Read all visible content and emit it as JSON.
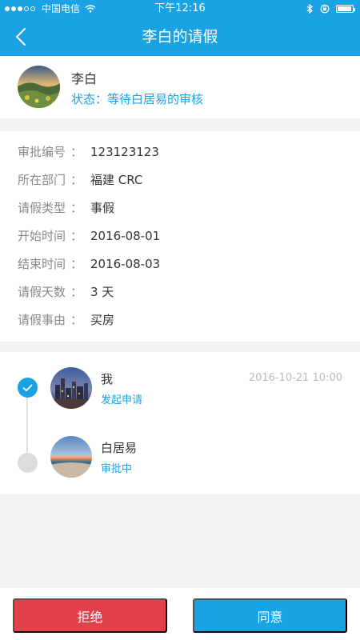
{
  "status_bar": {
    "carrier": "中国电信",
    "time": "下午12:16"
  },
  "nav": {
    "title": "李白的请假"
  },
  "profile": {
    "name": "李白",
    "status": "状态：等待白居易的审核"
  },
  "details": [
    {
      "label": "审批编号",
      "value": "123123123"
    },
    {
      "label": "所在部门",
      "value": "福建 CRC"
    },
    {
      "label": "请假类型",
      "value": "事假"
    },
    {
      "label": "开始时间",
      "value": "2016-08-01"
    },
    {
      "label": "结束时间",
      "value": "2016-08-03"
    },
    {
      "label": "请假天数",
      "value": "3 天"
    },
    {
      "label": "请假事由",
      "value": "买房"
    }
  ],
  "colon": "：",
  "flow": [
    {
      "name": "我",
      "state": "发起申请",
      "time": "2016-10-21 10:00"
    },
    {
      "name": "白居易",
      "state": "审批中"
    }
  ],
  "actions": {
    "reject_label": "拒绝",
    "approve_label": "同意"
  },
  "colors": {
    "primary": "#1aa3e4",
    "reject": "#e2414b"
  }
}
